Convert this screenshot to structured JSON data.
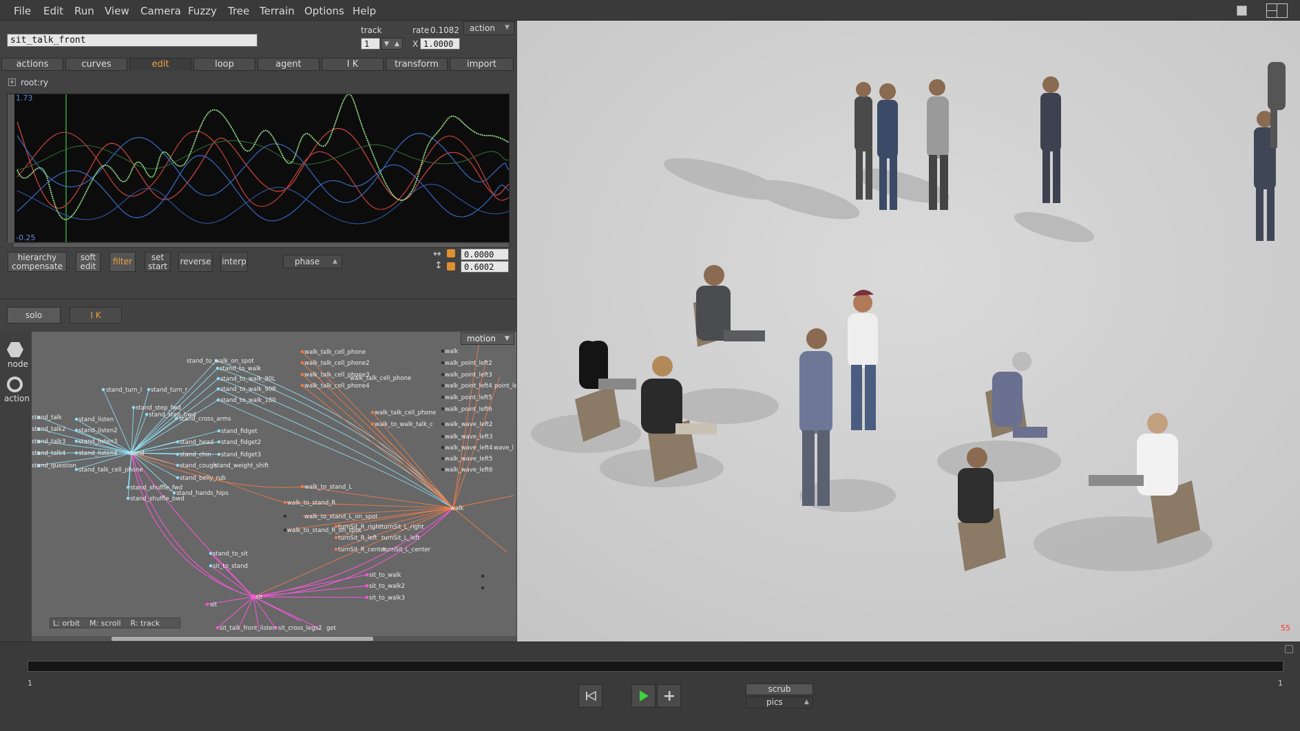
{
  "menu": [
    "File",
    "Edit",
    "Run",
    "View",
    "Camera",
    "Fuzzy",
    "Tree",
    "Terrain",
    "Options",
    "Help"
  ],
  "motion_name": "sit_talk_front",
  "track": {
    "label": "track",
    "value": "1"
  },
  "rate": {
    "label": "rate",
    "value": "0.1082",
    "x_label": "X",
    "x_value": "1.0000"
  },
  "action_dropdown": "action",
  "tabs": [
    "actions",
    "curves",
    "edit",
    "loop",
    "agent",
    "I K",
    "transform",
    "import"
  ],
  "active_tab": "edit",
  "curve": {
    "channel": "root:ry",
    "max_label": "1.73",
    "min_label": "-0.25"
  },
  "edit_buttons": {
    "hierarchy": "hierarchy\ncompensate",
    "soft_edit": "soft\nedit",
    "filter": "filter",
    "set_start": "set\nstart",
    "reverse": "reverse",
    "interp": "interp",
    "phase": "phase"
  },
  "offsets": {
    "h": "0.0000",
    "v": "0.6002"
  },
  "solo": "solo",
  "ik": "I K",
  "side_tools": {
    "node": "node",
    "action": "action"
  },
  "graph_dropdown": "motion",
  "graph_hint": {
    "orbit": "L: orbit",
    "scroll": "M: scroll",
    "track": "R: track"
  },
  "nodes": {
    "stand": [
      "stand",
      "stand_to_walk_on_spot",
      "stand_to_walk",
      "stand_to_walk_90L",
      "stand_to_walk_90R",
      "stand_to_walk_180",
      "stand_turn_l",
      "stand_turn_r",
      "stand_step_fwd",
      "stand_step_bwd",
      "stand_cross_arms",
      "stand_talk",
      "stand_listen",
      "stand_talk2",
      "stand_listen2",
      "stand_talk3",
      "stand_listen3",
      "stand_talk4",
      "stand_listen4",
      "stand_question",
      "stand_talk_cell_phone",
      "stand_fidget",
      "stand_fidget2",
      "stand_fidget3",
      "stand_head",
      "stand_chin",
      "stand_cough",
      "stand_weight_shift",
      "stand_belly_rub",
      "stand_shuffle_fwd",
      "stand_shuffle_bwd",
      "stand_hands_hips",
      "stand_to_sit",
      "sit_to_stand"
    ],
    "walk": [
      "walk",
      "walk_talk_cell_phone",
      "walk_talk_cell_phone2",
      "walk_talk_cell_phone3",
      "walk_talk_cell_phone4",
      "walk_talk_cell_phone",
      "walk_talk_cell_phone",
      "walk_to_walk_talk_c",
      "walk_to_stand_L",
      "walk_to_stand_R",
      "walk_to_stand_L_on_spot",
      "walk_to_stand_R_on_spot",
      "turnSit_R_right",
      "turnSit_L_right",
      "turnSit_R_left",
      "turnSit_L_left",
      "turnSit_R_center",
      "turnSit_L_center"
    ],
    "sit": [
      "sit",
      "sit",
      "sit_to_walk",
      "sit_to_walk2",
      "sit_to_walk3",
      "sit_talk_front_listen",
      "sit_cross_legs2",
      "get"
    ],
    "right": [
      "walk",
      "walk_point_left2",
      "walk_point_left3",
      "walk_point_left4",
      "point_le",
      "walk_point_left5",
      "walk_point_left6",
      "walk_wave_left2",
      "walk_wave_left3",
      "walk_wave_left4",
      "wave_l",
      "walk_wave_left5",
      "walk_wave_left6"
    ]
  },
  "viewport": {
    "frame_counter": "55"
  },
  "timeline": {
    "start": "1",
    "end": "1"
  },
  "playback": {
    "scrub": "scrub",
    "pics": "pics"
  },
  "colors": {
    "stand": "#7fd4f0",
    "walk": "#ec7a48",
    "sit": "#ff55dd",
    "accent": "#f0a040"
  }
}
